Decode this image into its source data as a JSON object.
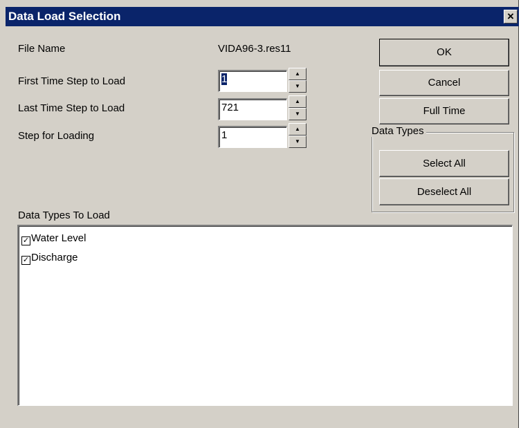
{
  "window": {
    "title": "Data Load Selection",
    "close_label": "×"
  },
  "file": {
    "label": "File Name",
    "value": "VIDA96-3.res11"
  },
  "steps": [
    {
      "label": "First Time Step to Load",
      "value": "1",
      "selected": true
    },
    {
      "label": "Last Time Step to Load",
      "value": "721",
      "selected": false
    },
    {
      "label": "Step for Loading",
      "value": "1",
      "selected": false
    }
  ],
  "buttons": {
    "ok": "OK",
    "cancel": "Cancel",
    "full_time": "Full Time"
  },
  "data_types_group": {
    "legend": "Data Types",
    "select_all": "Select All",
    "deselect_all": "Deselect All"
  },
  "list": {
    "label": "Data Types To Load",
    "items": [
      {
        "label": "Water Level",
        "checked": true
      },
      {
        "label": "Discharge",
        "checked": true
      }
    ]
  },
  "icons": {
    "check": "check-icon",
    "spin_up": "arrow-up-icon",
    "spin_down": "arrow-down-icon",
    "close": "close-icon"
  }
}
